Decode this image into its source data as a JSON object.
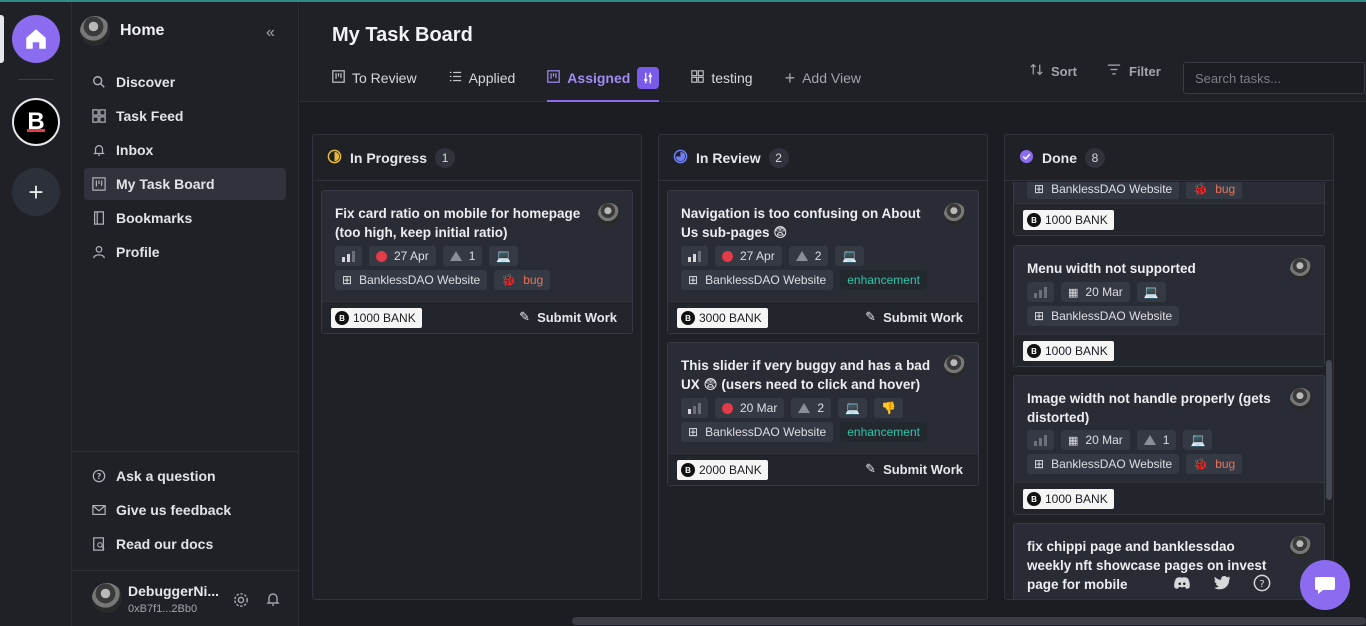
{
  "sidebar": {
    "title": "Home",
    "nav": [
      {
        "label": "Discover",
        "icon": "search-icon"
      },
      {
        "label": "Task Feed",
        "icon": "grid-icon"
      },
      {
        "label": "Inbox",
        "icon": "bell-icon"
      },
      {
        "label": "My Task Board",
        "icon": "board-icon",
        "active": true
      },
      {
        "label": "Bookmarks",
        "icon": "bookmark-icon"
      },
      {
        "label": "Profile",
        "icon": "user-icon"
      }
    ],
    "help": [
      {
        "label": "Ask a question",
        "icon": "question-icon"
      },
      {
        "label": "Give us feedback",
        "icon": "mail-icon"
      },
      {
        "label": "Read our docs",
        "icon": "docs-icon"
      }
    ],
    "user": {
      "name": "DebuggerNi...",
      "address": "0xB7f1...2Bb0"
    }
  },
  "rail": {
    "dao_letter": "B"
  },
  "header": {
    "title": "My Task Board",
    "tabs": [
      {
        "label": "To Review",
        "icon": "board-icon"
      },
      {
        "label": "Applied",
        "icon": "list-icon"
      },
      {
        "label": "Assigned",
        "icon": "board-icon",
        "active": true
      },
      {
        "label": "testing",
        "icon": "grid-icon"
      },
      {
        "label": "Add View",
        "icon": "plus-icon"
      }
    ],
    "sort_label": "Sort",
    "filter_label": "Filter",
    "search_placeholder": "Search tasks..."
  },
  "columns": [
    {
      "title": "In Progress",
      "count": "1",
      "status_color": "#e8b93a",
      "cards": [
        {
          "title": "Fix card ratio on mobile for homepage (too high, keep initial ratio)",
          "date": "27 Apr",
          "points": "1",
          "project": "BanklessDAO Website",
          "tag": "bug",
          "tag_type": "bug",
          "reward": "1000 BANK",
          "action": "Submit Work"
        }
      ]
    },
    {
      "title": "In Review",
      "count": "2",
      "status_color": "#6f7ff0",
      "cards": [
        {
          "title": "Navigation is too confusing on About Us sub-pages 😨",
          "date": "27 Apr",
          "points": "2",
          "project": "BanklessDAO Website",
          "tag": "enhancement",
          "tag_type": "enh",
          "reward": "3000 BANK",
          "action": "Submit Work"
        },
        {
          "title": "This slider if very buggy and has a bad UX 😨 (users need to click and hover)",
          "date": "20 Mar",
          "points": "2",
          "emoji": "👎",
          "project": "BanklessDAO Website",
          "tag": "enhancement",
          "tag_type": "enh",
          "reward": "2000 BANK",
          "action": "Submit Work"
        }
      ]
    },
    {
      "title": "Done",
      "count": "8",
      "status_color": "#8b6cf0",
      "cards": [
        {
          "project": "BanklessDAO Website",
          "tag": "bug",
          "reward": "1000 BANK"
        },
        {
          "title": "Menu width not supported",
          "date": "20 Mar",
          "project": "BanklessDAO Website",
          "reward": "1000 BANK"
        },
        {
          "title": "Image width not handle properly (gets distorted)",
          "date": "20 Mar",
          "points": "1",
          "project": "BanklessDAO Website",
          "tag": "bug",
          "reward": "1000 BANK"
        },
        {
          "title": "fix chippi page and banklessdao weekly nft showcase pages on invest page for mobile"
        }
      ]
    }
  ],
  "colors": {
    "accent": "#8b6cf0",
    "bug": "#e8745b",
    "enhancement": "#2cc6a8"
  }
}
